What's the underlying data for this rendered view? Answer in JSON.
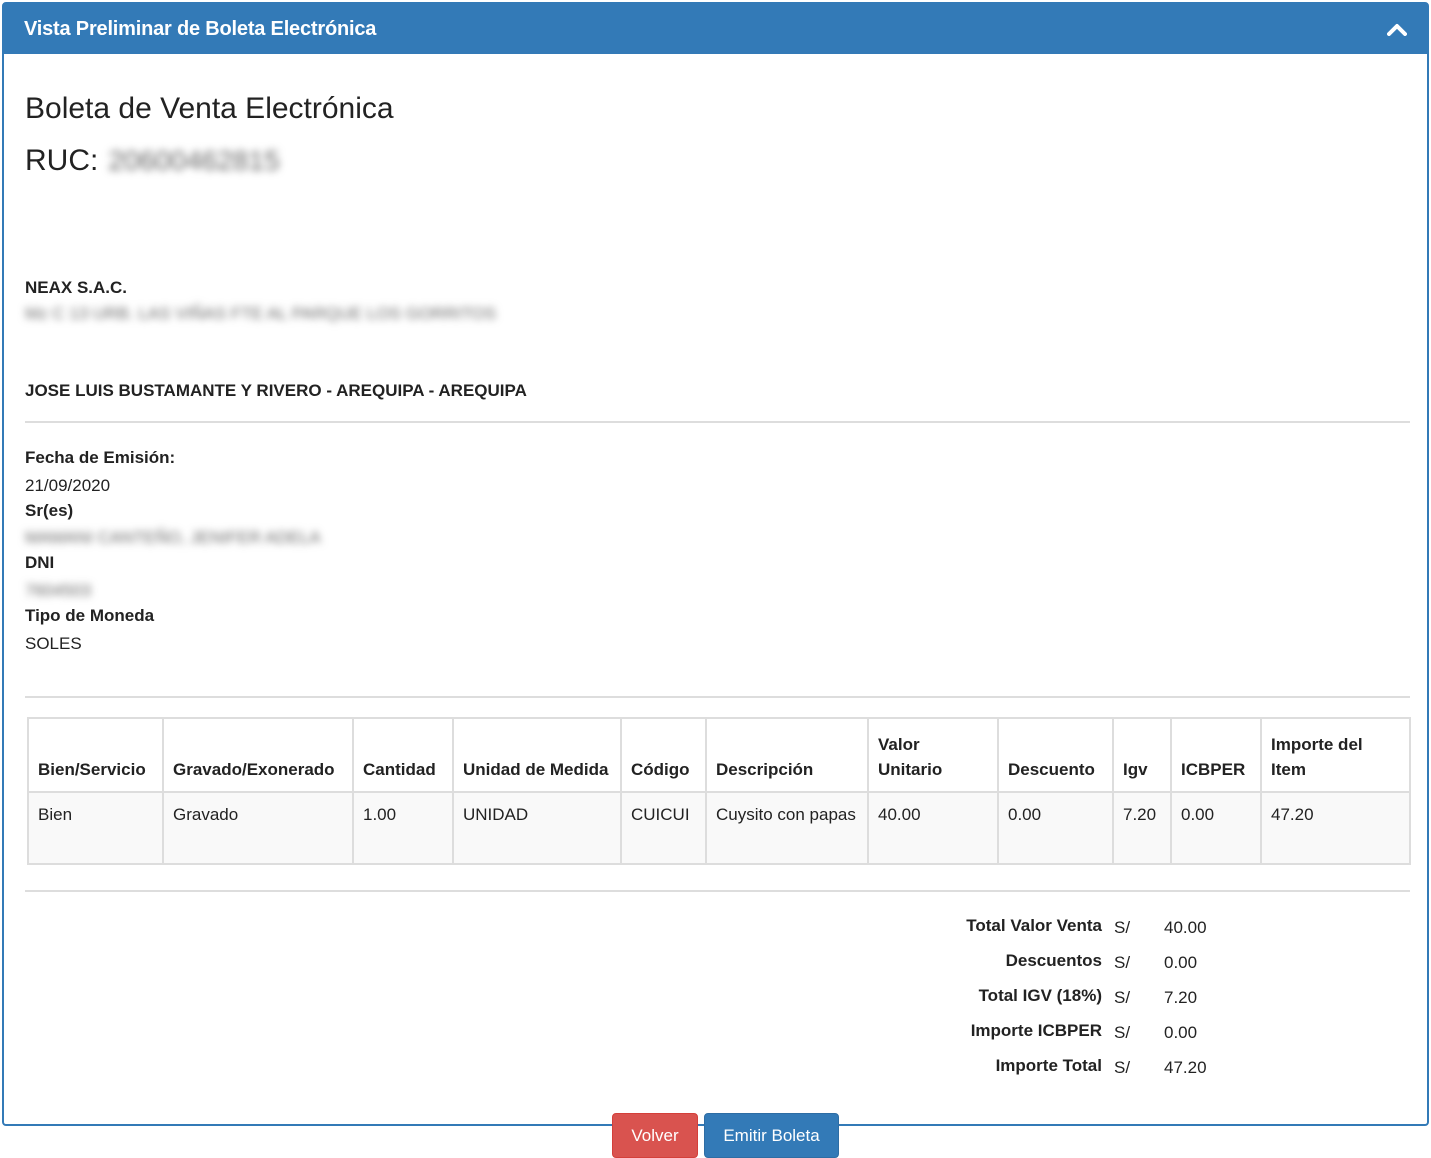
{
  "header": {
    "title": "Vista Preliminar de Boleta Electrónica"
  },
  "document": {
    "title": "Boleta de Venta Electrónica",
    "ruc_label": "RUC:",
    "ruc_value": "20600462815",
    "company_name": "NEAX S.A.C.",
    "company_address": "Mz C 13 URB. LAS VIÑAS FTE AL PARQUE LOS GORRITOS",
    "district": "JOSE LUIS BUSTAMANTE Y RIVERO - AREQUIPA - AREQUIPA"
  },
  "info": {
    "fecha_label": "Fecha de Emisión:",
    "fecha_value": "21/09/2020",
    "cliente_label": "Sr(es)",
    "cliente_value": "MAMANI CANTEÑO, JENIFER ADELA",
    "dni_label": "DNI",
    "dni_value": "7604503",
    "moneda_label": "Tipo de Moneda",
    "moneda_value": "SOLES"
  },
  "table": {
    "headers": [
      "Bien/Servicio",
      "Gravado/Exonerado",
      "Cantidad",
      "Unidad de Medida",
      "Código",
      "Descripción",
      "Valor Unitario",
      "Descuento",
      "Igv",
      "ICBPER",
      "Importe del Item"
    ],
    "rows": [
      [
        "Bien",
        "Gravado",
        "1.00",
        "UNIDAD",
        "CUICUI",
        "Cuysito con papas",
        "40.00",
        "0.00",
        "7.20",
        "0.00",
        "47.20"
      ]
    ]
  },
  "totals": [
    {
      "label": "Total Valor Venta",
      "currency": "S/",
      "value": "40.00"
    },
    {
      "label": "Descuentos",
      "currency": "S/",
      "value": "0.00"
    },
    {
      "label": "Total IGV (18%)",
      "currency": "S/",
      "value": "7.20"
    },
    {
      "label": "Importe ICBPER",
      "currency": "S/",
      "value": "0.00"
    },
    {
      "label": "Importe Total",
      "currency": "S/",
      "value": "47.20"
    }
  ],
  "actions": {
    "back_label": "Volver",
    "emit_label": "Emitir Boleta"
  },
  "colors": {
    "primary": "#337ab7",
    "danger": "#d9534f"
  }
}
